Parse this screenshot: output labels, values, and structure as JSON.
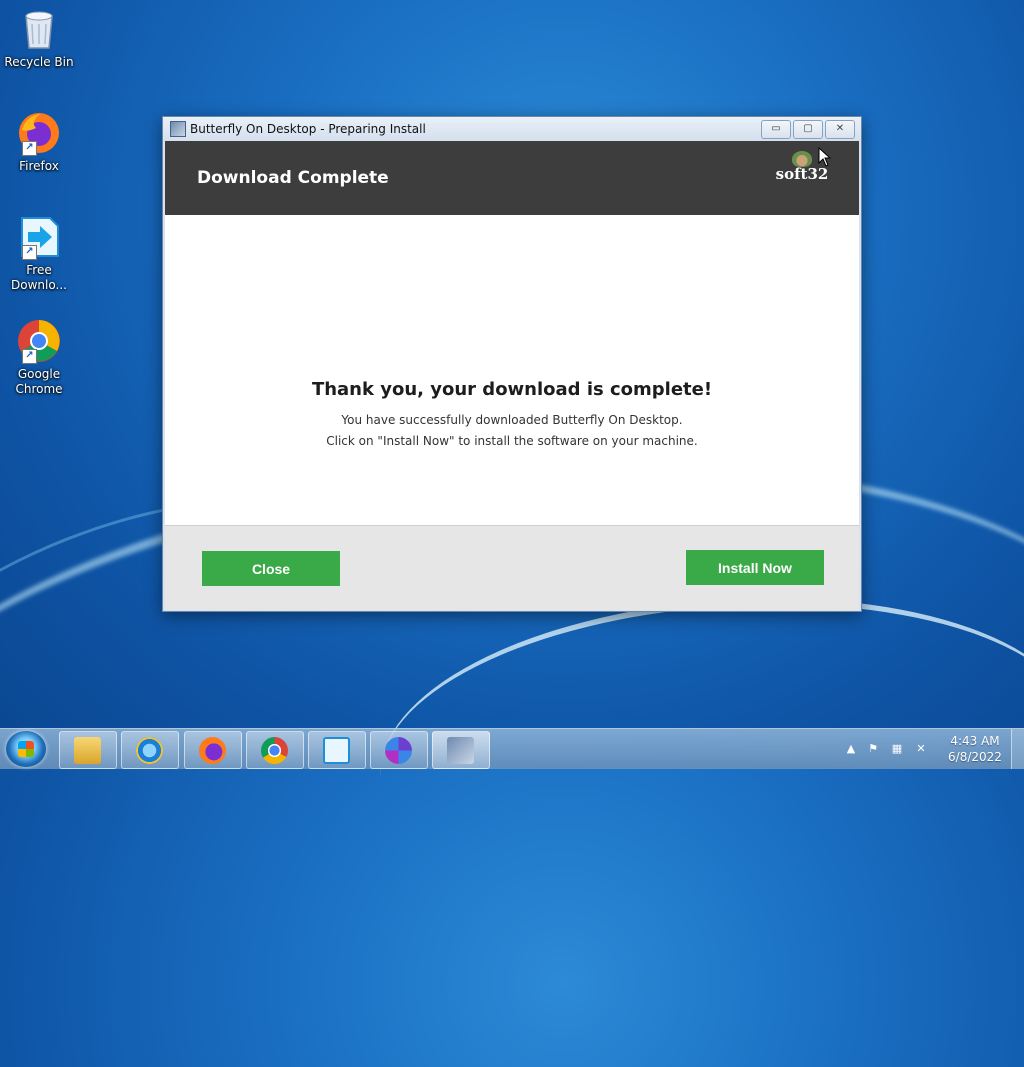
{
  "desktop": {
    "icons": [
      {
        "label": "Recycle Bin"
      },
      {
        "label": "Firefox"
      },
      {
        "label": "Free Downlo..."
      },
      {
        "label": "Google Chrome"
      }
    ]
  },
  "window": {
    "title": "Butterfly On Desktop - Preparing Install",
    "controls": {
      "minimize": "▭",
      "maximize": "▢",
      "close": "✕"
    },
    "header_title": "Download Complete",
    "logo_text": "soft32",
    "heading": "Thank you, your download is complete!",
    "message_line1": "You have successfully downloaded Butterfly On Desktop.",
    "message_line2": "Click on \"Install Now\" to install the software on your machine.",
    "close_label": "Close",
    "install_label": "Install Now",
    "accent_color": "#3aaa48",
    "header_color": "#3d3d3d"
  },
  "taskbar": {
    "pinned": [
      "explorer-icon",
      "internet-explorer-icon",
      "firefox-icon",
      "chrome-icon",
      "free-download-manager-icon",
      "media-icon",
      "installer-icon"
    ],
    "clock": {
      "time": "4:43 AM",
      "date": "6/8/2022"
    },
    "tray_icons": [
      "show-hidden-icons",
      "action-center-flag-icon",
      "network-icon",
      "volume-muted-icon"
    ]
  }
}
